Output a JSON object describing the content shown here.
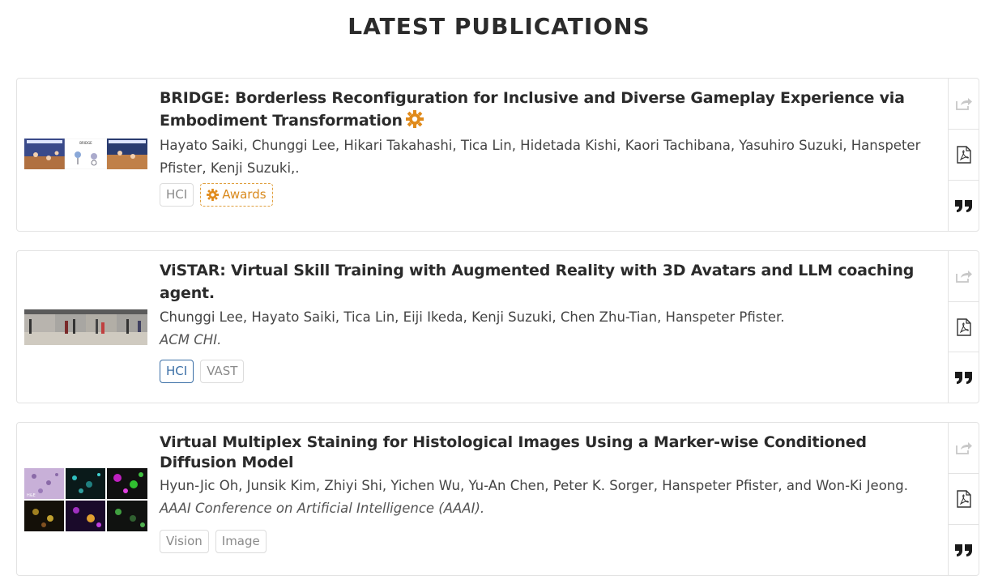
{
  "header": {
    "title": "LATEST PUBLICATIONS"
  },
  "colors": {
    "award": "#e08a1a",
    "active_tag": "#3b6fa6",
    "icon_gray": "#c8c8c8",
    "icon_dark": "#2b2b2b"
  },
  "publications": [
    {
      "title": "BRIDGE: Borderless Reconfiguration for Inclusive and Diverse Gameplay Experience via Embodiment Transformation",
      "authors": "Hayato Saiki, Chunggi Lee, Hikari Takahashi, Tica Lin, Hidetada Kishi, Kaori Tachibana, Yasuhiro Suzuki, Hanspeter Pfister, Kenji Suzuki,.",
      "venue": "",
      "award_icon": "gear-icon",
      "tags": [
        "HCI",
        "Awards"
      ],
      "thumbnail_text": {
        "center": "BRIDGE"
      }
    },
    {
      "title": "ViSTAR: Virtual Skill Training with Augmented Reality with 3D Avatars and LLM coaching agent.",
      "authors": "Chunggi Lee, Hayato Saiki, Tica Lin, Eiji Ikeda, Kenji Suzuki, Chen Zhu-Tian, Hanspeter Pfister.",
      "venue": "ACM CHI.",
      "tags": [
        "HCI",
        "VAST"
      ]
    },
    {
      "title": "Virtual Multiplex Staining for Histological Images Using a Marker-wise Conditioned Diffusion Model",
      "authors": "Hyun-Jic Oh, Junsik Kim, Zhiyi Shi, Yichen Wu, Yu-An Chen, Peter K. Sorger, Hanspeter Pfister, and Won-Ki Jeong.",
      "venue": "AAAI Conference on Artificial Intelligence (AAAI).",
      "tags": [
        "Vision",
        "Image"
      ],
      "thumbnail_text": {
        "panel_1": "H&E"
      }
    }
  ],
  "side_icons": [
    "share-icon",
    "pdf-icon",
    "quote-icon"
  ]
}
